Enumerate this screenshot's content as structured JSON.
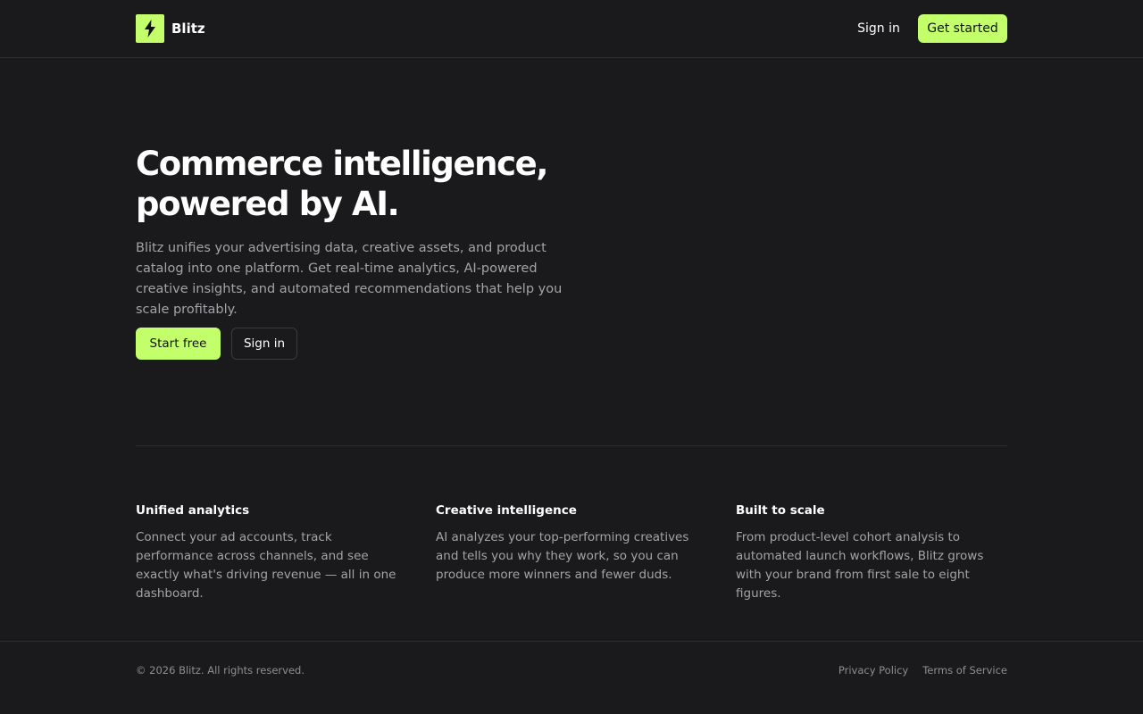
{
  "brand": {
    "name": "Blitz",
    "logo_icon": "lightning-bolt-icon",
    "accent_color": "#c3ff6b"
  },
  "nav": {
    "signin_label": "Sign in",
    "cta_label": "Get started"
  },
  "hero": {
    "title_line1": "Commerce intelligence,",
    "title_line2": "powered by AI.",
    "subtitle": "Blitz unifies your advertising data, creative assets, and product catalog into one platform. Get real-time analytics, AI-powered creative insights, and automated recommendations that help you scale profitably.",
    "primary_cta": "Start free",
    "secondary_cta": "Sign in"
  },
  "features": [
    {
      "title": "Unified analytics",
      "description": "Connect your ad accounts, track performance across channels, and see exactly what's driving revenue — all in one dashboard."
    },
    {
      "title": "Creative intelligence",
      "description": "AI analyzes your top-performing creatives and tells you why they work, so you can produce more winners and fewer duds."
    },
    {
      "title": "Built to scale",
      "description": "From product-level cohort analysis to automated launch workflows, Blitz grows with your brand from first sale to eight figures."
    }
  ],
  "footer": {
    "copyright": "© 2026 Blitz. All rights reserved.",
    "links": [
      "Privacy Policy",
      "Terms of Service"
    ]
  }
}
